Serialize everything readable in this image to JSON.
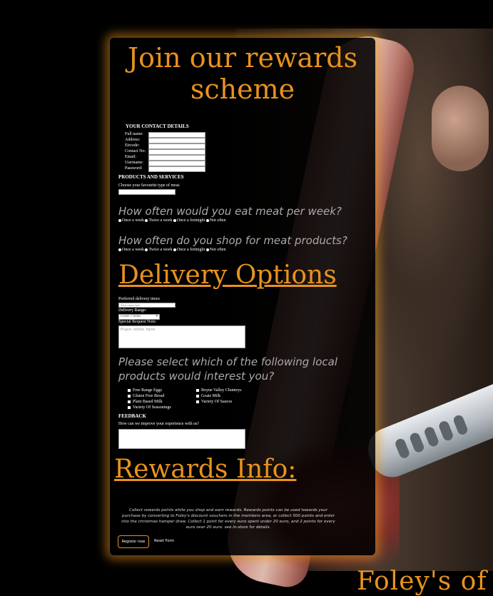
{
  "page": {
    "footer_title": "Foley's of I"
  },
  "form": {
    "heading": "Join our rewards scheme",
    "contact_section": "YOUR CONTACT DETAILS",
    "contact_fields": [
      {
        "label": "Full name:"
      },
      {
        "label": "Address:"
      },
      {
        "label": "Eircode:"
      },
      {
        "label": "Contact No:"
      },
      {
        "label": "Email:"
      },
      {
        "label": "Username:"
      },
      {
        "label": "Password:"
      }
    ],
    "products_section": "PRODUCTS AND SERVICES",
    "favourite_meat_label": "Choose your favourite type of meat.",
    "q1": "How often would you eat meat per week?",
    "q2": "How often do you shop for meat products?",
    "freq_options": [
      "Once a week",
      "Twice a week",
      "Once a fortnight",
      "Not often"
    ],
    "delivery_heading": "Delivery Options",
    "delivery_times_label": "Preferred delivery times",
    "delivery_times_placeholder": "Select times here",
    "delivery_range_label": "Delivery Range:",
    "delivery_range_value": "Under 1 miles",
    "special_request_label": "Special Request Note:",
    "special_request_placeholder": "Place notes here",
    "local_products_question": "Please select which of the following local products would interest you?",
    "local_products_left": [
      "Free Range Eggs",
      "Gluten Free Bread",
      "Plant Based Milk",
      "Variety Of Seasonings"
    ],
    "local_products_right": [
      "Boyne Valley Chutneys",
      "Goats Milk",
      "Variety Of Sauces"
    ],
    "feedback_section": "FEEDBACK",
    "feedback_label": "How can we improve your experience with us?",
    "rewards_heading": "Rewards Info:",
    "rewards_text": "Collect rewards points while you shop and earn rewards. Rewards points can be used towards your purchase by converting to Foley's discount vouchers in the members area, or collect 500 points and enter into the christmas hamper draw. Collect 1 point for every euro spent under 20 euro, and 2 points for every euro over 20 euro. see in-store for details.",
    "register_button": "Register now",
    "reset_button": "Reset Form"
  },
  "colors": {
    "accent": "#e8921e",
    "panel_bg": "#000000",
    "question_text": "#aaaaaa"
  }
}
